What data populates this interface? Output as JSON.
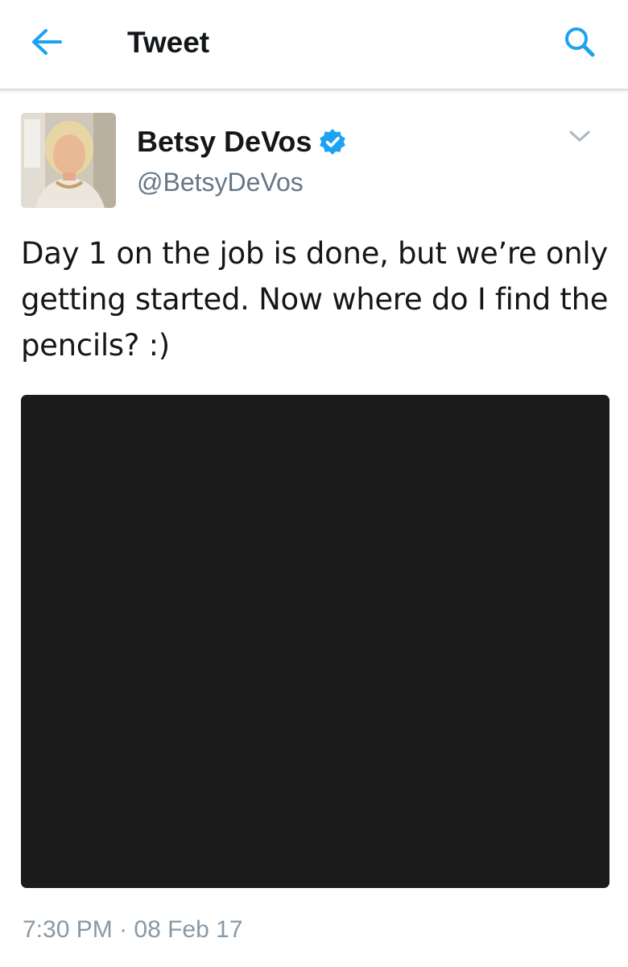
{
  "header": {
    "title": "Tweet",
    "back_icon": "arrow-left-icon",
    "search_icon": "search-icon",
    "accent_color": "#1da1f2"
  },
  "tweet": {
    "author_name": "Betsy DeVos",
    "author_handle": "@BetsyDeVos",
    "verified_icon": "verified-badge-icon",
    "menu_icon": "chevron-down-icon",
    "text": "Day 1 on the job is done, but we’re only getting started. Now where do I find the pencils? :)",
    "time": "7:30 PM",
    "separator": " · ",
    "date": "08 Feb 17"
  }
}
